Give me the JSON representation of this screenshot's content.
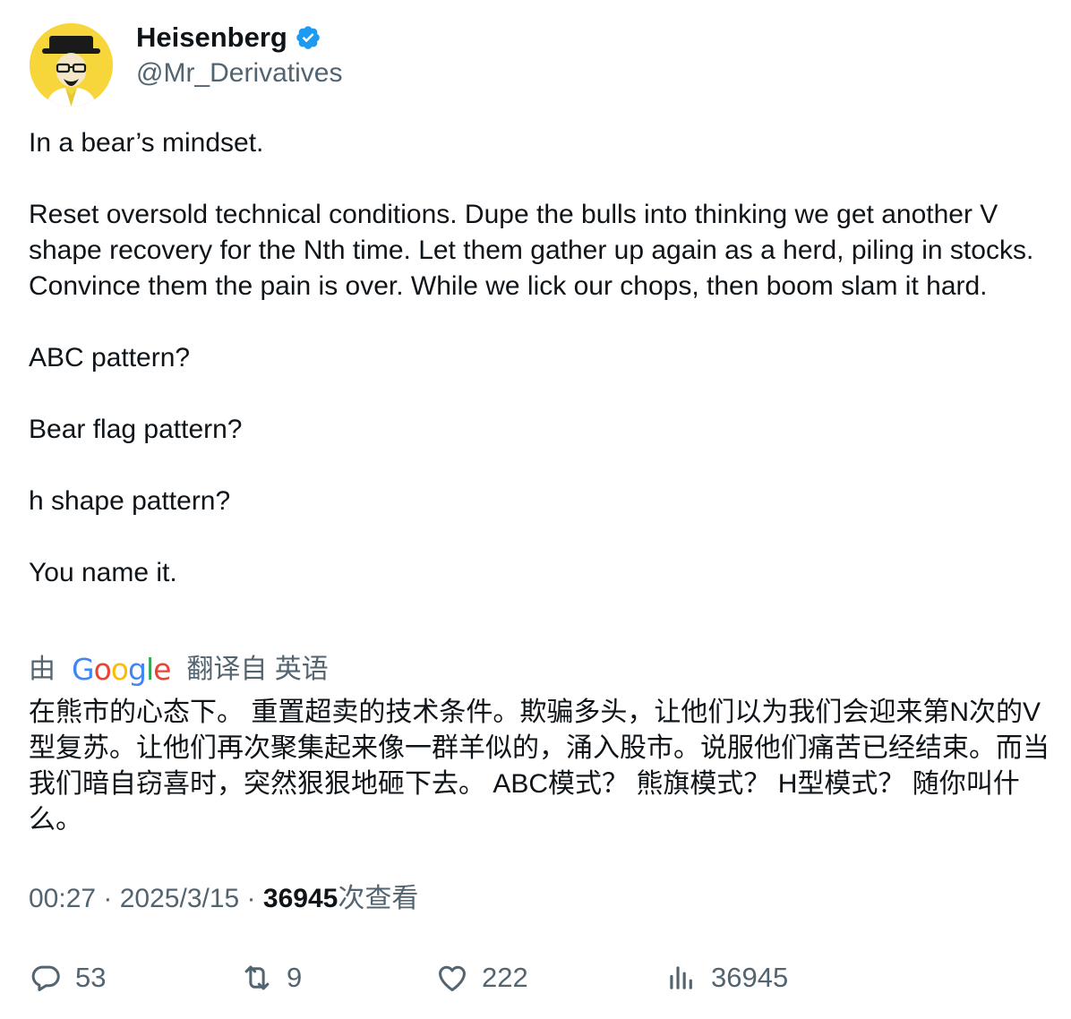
{
  "author": {
    "display_name": "Heisenberg",
    "handle": "@Mr_Derivatives",
    "verified_color": "#1d9bf0",
    "avatar_bg": "#f6d63a"
  },
  "tweet": {
    "paragraphs": [
      "In a bear’s mindset.",
      "Reset oversold technical conditions. Dupe the bulls into thinking we get another V shape recovery for the Nth time. Let them gather up again as a herd, piling in stocks. Convince them the pain is over. While we lick our chops, then boom slam it hard.",
      "ABC pattern?",
      "Bear flag pattern?",
      "h shape pattern?",
      "You name it."
    ]
  },
  "translation": {
    "prefix": "由",
    "provider": "Google",
    "suffix": "翻译自 英语",
    "text": "在熊市的心态下。 重置超卖的技术条件。欺骗多头，让他们以为我们会迎来第N次的V型复苏。让他们再次聚集起来像一群羊似的，涌入股市。说服他们痛苦已经结束。而当我们暗自窃喜时，突然狠狠地砸下去。 ABC模式？ 熊旗模式？ H型模式？ 随你叫什么。"
  },
  "meta": {
    "time": "00:27",
    "sep1": " · ",
    "date": "2025/3/15",
    "sep2": " · ",
    "views": "36945",
    "views_label": "次查看"
  },
  "actions": {
    "replies": "53",
    "retweets": "9",
    "likes": "222",
    "views": "36945"
  },
  "colors": {
    "text": "#0f1419",
    "secondary": "#536471",
    "google_blue": "#4285f4",
    "google_red": "#ea4335",
    "google_yellow": "#fbbc05",
    "google_green": "#34a853"
  }
}
